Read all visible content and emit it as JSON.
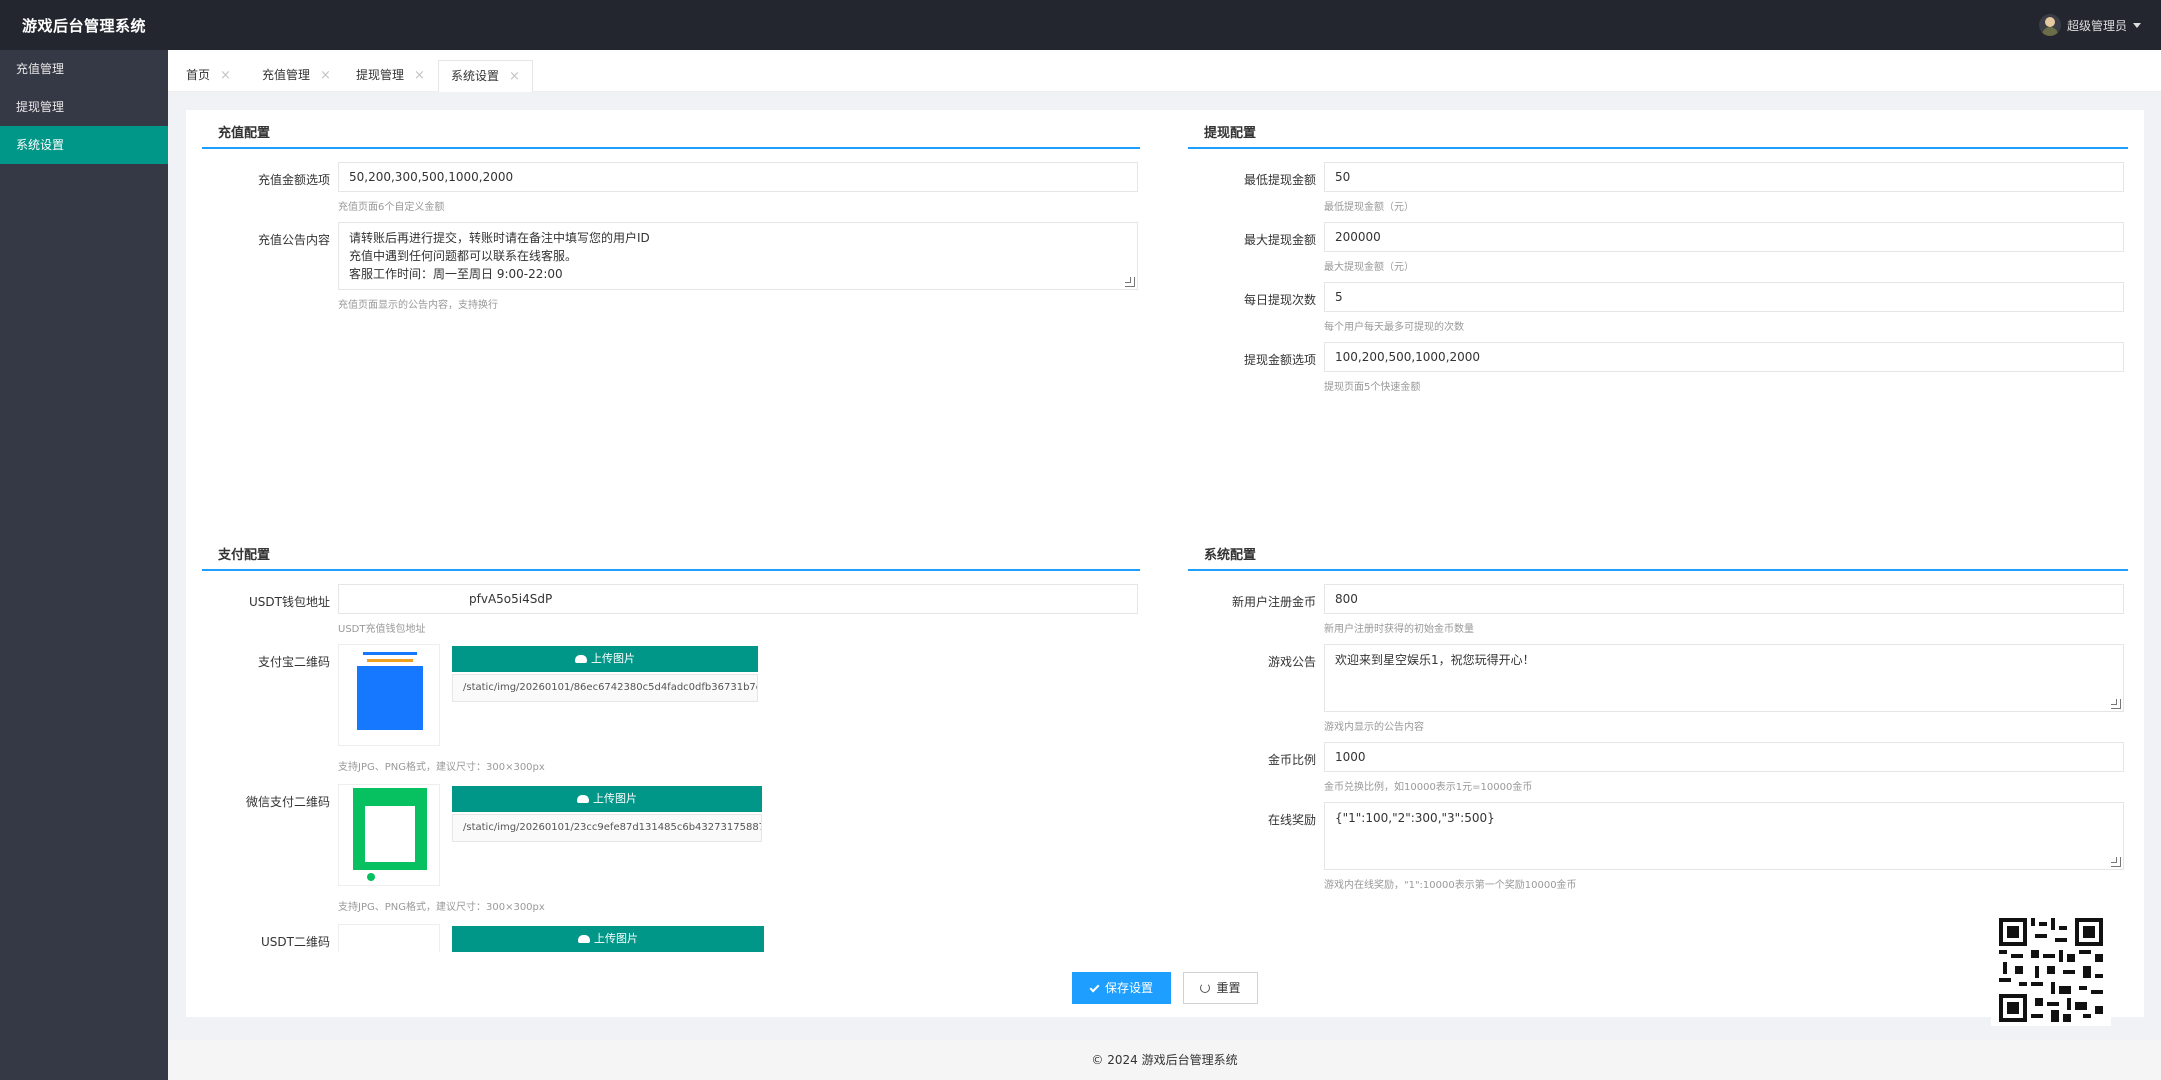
{
  "app": {
    "title": "游戏后台管理系统",
    "user": "超级管理员"
  },
  "sidebar": {
    "items": [
      {
        "label": "充值管理"
      },
      {
        "label": "提现管理"
      },
      {
        "label": "系统设置"
      }
    ]
  },
  "tabs": [
    {
      "label": "首页"
    },
    {
      "label": "充值管理"
    },
    {
      "label": "提现管理"
    },
    {
      "label": "系统设置"
    }
  ],
  "recharge": {
    "title": "充值配置",
    "amounts_label": "充值金额选项",
    "amounts_value": "50,200,300,500,1000,2000",
    "amounts_hint": "充值页面6个自定义金额",
    "notice_label": "充值公告内容",
    "notice_lines": [
      "请转账后再进行提交，转账时请在备注中填写您的用户ID",
      "充值中遇到任何问题都可以联系在线客服。",
      "客服工作时间：周一至周日 9:00-22:00"
    ],
    "notice_hint": "充值页面显示的公告内容，支持换行"
  },
  "withdraw": {
    "title": "提现配置",
    "fields": [
      {
        "label": "最低提现金额",
        "value": "50",
        "hint": "最低提现金额（元）"
      },
      {
        "label": "最大提现金额",
        "value": "200000",
        "hint": "最大提现金额（元）"
      },
      {
        "label": "每日提现次数",
        "value": "5",
        "hint": "每个用户每天最多可提现的次数"
      },
      {
        "label": "提现金额选项",
        "value": "100,200,500,1000,2000",
        "hint": "提现页面5个快速金额"
      }
    ]
  },
  "payment": {
    "title": "支付配置",
    "usdt_label": "USDT钱包地址",
    "usdt_value": "pfvA5o5i4SdP",
    "usdt_hint": "USDT充值钱包地址",
    "alipay_label": "支付宝二维码",
    "alipay_path": "/static/img/20260101/86ec6742380c5d4fadc0dfb36731b7ee.jpg",
    "wechat_label": "微信支付二维码",
    "wechat_path": "/static/img/20260101/23cc9efe87d131485c6b432731758877.jpg",
    "upload_label": "上传图片",
    "format_hint": "支持JPG、PNG格式，建议尺寸：300×300px",
    "usdt_qr_label": "USDT二维码"
  },
  "system": {
    "title": "系统配置",
    "reg_label": "新用户注册金币",
    "reg_value": "800",
    "reg_hint": "新用户注册时获得的初始金币数量",
    "notice_label": "游戏公告",
    "notice_value": "欢迎来到星空娱乐1，祝您玩得开心！",
    "notice_hint": "游戏内显示的公告内容",
    "ratio_label": "金币比例",
    "ratio_value": "1000",
    "ratio_hint": "金币兑换比例，如10000表示1元=10000金币",
    "online_label": "在线奖励",
    "online_value": "{\"1\":100,\"2\":300,\"3\":500}",
    "online_hint": "游戏内在线奖励，\"1\":10000表示第一个奖励10000金币"
  },
  "actions": {
    "save": "保存设置",
    "reset": "重置"
  },
  "footer": "© 2024 游戏后台管理系统",
  "colors": {
    "header": "#23262e",
    "sidebar": "#353845",
    "active": "#009688",
    "primary": "#1e9fff"
  }
}
